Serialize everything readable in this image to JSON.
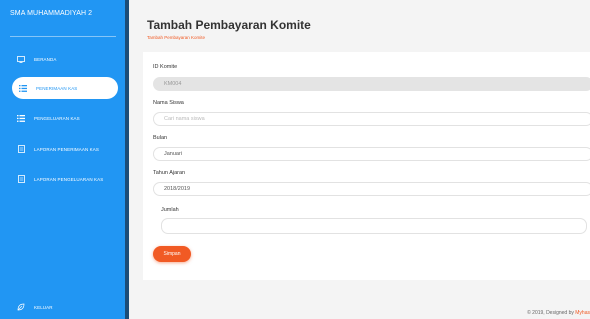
{
  "sidebar": {
    "brand": "SMA MUHAMMADIYAH 2",
    "items": [
      {
        "label": "BERANDA",
        "icon": "monitor-icon"
      },
      {
        "label": "PENERIMAAN KAS",
        "icon": "list-icon"
      },
      {
        "label": "PENGELUARAN KAS",
        "icon": "list-icon"
      },
      {
        "label": "LAPORAN PENERIMAAN KAS",
        "icon": "document-icon"
      },
      {
        "label": "LAPORAN PENGELUARAN KAS",
        "icon": "document-icon"
      }
    ],
    "logout": {
      "label": "KELUAR",
      "icon": "leaf-icon"
    }
  },
  "page": {
    "title": "Tambah Pembayaran Komite",
    "breadcrumb": "Tambah Pembayaran Komite"
  },
  "form": {
    "id_label": "ID Komite",
    "id_value": "KM004",
    "nama_label": "Nama Siswa",
    "nama_placeholder": "Cari nama siswa",
    "bulan_label": "Bulan",
    "bulan_value": "Januari",
    "tahun_label": "Tahun Ajaran",
    "tahun_value": "2018/2019",
    "jumlah_label": "Jumlah",
    "jumlah_value": "",
    "save_label": "Simpan"
  },
  "footer": {
    "text": "© 2019, Designed by",
    "link": "Myhas"
  },
  "colors": {
    "sidebar": "#2196f3",
    "accent": "#f15a24"
  }
}
